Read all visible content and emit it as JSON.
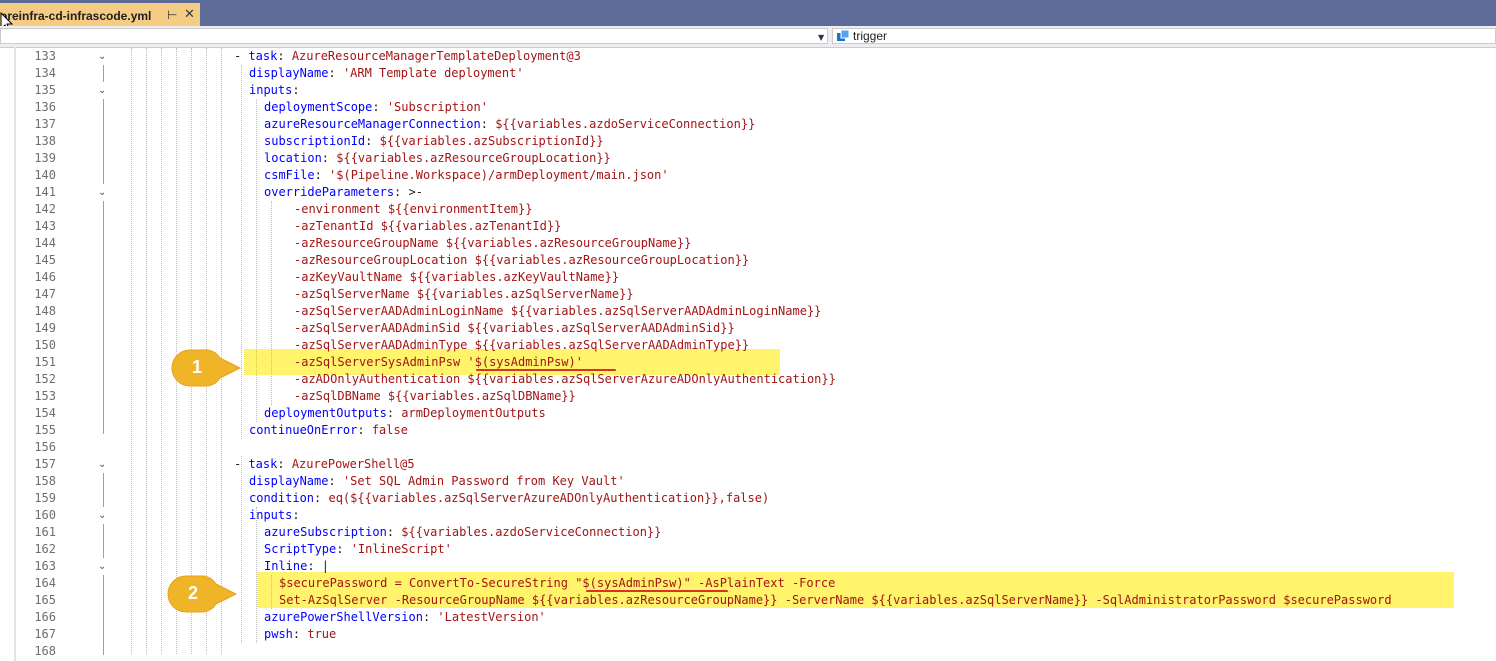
{
  "tab": {
    "title": "oreinfra-cd-infrascode.yml",
    "pin_glyph": "⊢",
    "close_glyph": "✕"
  },
  "navbar": {
    "right_icon": "trigger-icon",
    "right_label": "trigger"
  },
  "callouts": [
    {
      "label": "1"
    },
    {
      "label": "2"
    }
  ],
  "colors": {
    "tab_active": "#f5cc84",
    "titlebar": "#5d6b99",
    "highlight": "#fff46b",
    "underline": "#d9322a",
    "badge": "#f0b429",
    "key": "#0000ff",
    "value": "#a31515"
  },
  "lines": [
    {
      "n": "133",
      "fold": true,
      "parts": [
        [
          "p",
          "- "
        ],
        [
          "k",
          "task"
        ],
        [
          "p",
          ": "
        ],
        [
          "v",
          "AzureResourceManagerTemplateDeployment@3"
        ]
      ]
    },
    {
      "n": "134",
      "parts": [
        [
          "k",
          "displayName"
        ],
        [
          "p",
          ": "
        ],
        [
          "s",
          "'ARM Template deployment'"
        ]
      ]
    },
    {
      "n": "135",
      "fold": true,
      "parts": [
        [
          "k",
          "inputs"
        ],
        [
          "p",
          ":"
        ]
      ]
    },
    {
      "n": "136",
      "parts": [
        [
          "k",
          "deploymentScope"
        ],
        [
          "p",
          ": "
        ],
        [
          "s",
          "'Subscription'"
        ]
      ]
    },
    {
      "n": "137",
      "parts": [
        [
          "k",
          "azureResourceManagerConnection"
        ],
        [
          "p",
          ": "
        ],
        [
          "v",
          "${{variables.azdoServiceConnection}}"
        ]
      ]
    },
    {
      "n": "138",
      "parts": [
        [
          "k",
          "subscriptionId"
        ],
        [
          "p",
          ": "
        ],
        [
          "v",
          "${{variables.azSubscriptionId}}"
        ]
      ]
    },
    {
      "n": "139",
      "parts": [
        [
          "k",
          "location"
        ],
        [
          "p",
          ": "
        ],
        [
          "v",
          "${{variables.azResourceGroupLocation}}"
        ]
      ]
    },
    {
      "n": "140",
      "parts": [
        [
          "k",
          "csmFile"
        ],
        [
          "p",
          ": "
        ],
        [
          "s",
          "'$(Pipeline.Workspace)/armDeployment/main.json'"
        ]
      ]
    },
    {
      "n": "141",
      "fold": true,
      "parts": [
        [
          "k",
          "overrideParameters"
        ],
        [
          "p",
          ": >-"
        ]
      ]
    },
    {
      "n": "142",
      "parts": [
        [
          "v",
          "-environment ${{environmentItem}}"
        ]
      ]
    },
    {
      "n": "143",
      "parts": [
        [
          "v",
          "-azTenantId ${{variables.azTenantId}}"
        ]
      ]
    },
    {
      "n": "144",
      "parts": [
        [
          "v",
          "-azResourceGroupName ${{variables.azResourceGroupName}}"
        ]
      ]
    },
    {
      "n": "145",
      "parts": [
        [
          "v",
          "-azResourceGroupLocation ${{variables.azResourceGroupLocation}}"
        ]
      ]
    },
    {
      "n": "146",
      "parts": [
        [
          "v",
          "-azKeyVaultName ${{variables.azKeyVaultName}}"
        ]
      ]
    },
    {
      "n": "147",
      "parts": [
        [
          "v",
          "-azSqlServerName ${{variables.azSqlServerName}}"
        ]
      ]
    },
    {
      "n": "148",
      "parts": [
        [
          "v",
          "-azSqlServerAADAdminLoginName ${{variables.azSqlServerAADAdminLoginName}}"
        ]
      ]
    },
    {
      "n": "149",
      "parts": [
        [
          "v",
          "-azSqlServerAADAdminSid ${{variables.azSqlServerAADAdminSid}}"
        ]
      ]
    },
    {
      "n": "150",
      "parts": [
        [
          "v",
          "-azSqlServerAADAdminType ${{variables.azSqlServerAADAdminType}}"
        ]
      ]
    },
    {
      "n": "151",
      "parts": [
        [
          "v",
          "-azSqlServerSysAdminPsw '$(sysAdminPsw)'"
        ]
      ]
    },
    {
      "n": "152",
      "parts": [
        [
          "v",
          "-azADOnlyAuthentication ${{variables.azSqlServerAzureADOnlyAuthentication}}"
        ]
      ]
    },
    {
      "n": "153",
      "parts": [
        [
          "v",
          "-azSqlDBName ${{variables.azSqlDBName}}"
        ]
      ]
    },
    {
      "n": "154",
      "parts": [
        [
          "k",
          "deploymentOutputs"
        ],
        [
          "p",
          ": "
        ],
        [
          "v",
          "armDeploymentOutputs"
        ]
      ]
    },
    {
      "n": "155",
      "parts": [
        [
          "k",
          "continueOnError"
        ],
        [
          "p",
          ": "
        ],
        [
          "v",
          "false"
        ]
      ]
    },
    {
      "n": "156",
      "parts": []
    },
    {
      "n": "157",
      "fold": true,
      "parts": [
        [
          "p",
          "- "
        ],
        [
          "k",
          "task"
        ],
        [
          "p",
          ": "
        ],
        [
          "v",
          "AzurePowerShell@5"
        ]
      ]
    },
    {
      "n": "158",
      "parts": [
        [
          "k",
          "displayName"
        ],
        [
          "p",
          ": "
        ],
        [
          "s",
          "'Set SQL Admin Password from Key Vault'"
        ]
      ]
    },
    {
      "n": "159",
      "parts": [
        [
          "k",
          "condition"
        ],
        [
          "p",
          ": "
        ],
        [
          "v",
          "eq(${{variables.azSqlServerAzureADOnlyAuthentication}},false)"
        ]
      ]
    },
    {
      "n": "160",
      "fold": true,
      "parts": [
        [
          "k",
          "inputs"
        ],
        [
          "p",
          ":"
        ]
      ]
    },
    {
      "n": "161",
      "parts": [
        [
          "k",
          "azureSubscription"
        ],
        [
          "p",
          ": "
        ],
        [
          "v",
          "${{variables.azdoServiceConnection}}"
        ]
      ]
    },
    {
      "n": "162",
      "parts": [
        [
          "k",
          "ScriptType"
        ],
        [
          "p",
          ": "
        ],
        [
          "s",
          "'InlineScript'"
        ]
      ]
    },
    {
      "n": "163",
      "fold": true,
      "parts": [
        [
          "k",
          "Inline"
        ],
        [
          "p",
          ": |"
        ]
      ]
    },
    {
      "n": "164",
      "parts": [
        [
          "v",
          "$securePassword = ConvertTo-SecureString \"$(sysAdminPsw)\" -AsPlainText -Force"
        ]
      ]
    },
    {
      "n": "165",
      "parts": [
        [
          "v",
          "Set-AzSqlServer -ResourceGroupName ${{variables.azResourceGroupName}} -ServerName ${{variables.azSqlServerName}} -SqlAdministratorPassword $securePassword"
        ]
      ]
    },
    {
      "n": "166",
      "parts": [
        [
          "k",
          "azurePowerShellVersion"
        ],
        [
          "p",
          ": "
        ],
        [
          "s",
          "'LatestVersion'"
        ]
      ]
    },
    {
      "n": "167",
      "parts": [
        [
          "k",
          "pwsh"
        ],
        [
          "p",
          ": "
        ],
        [
          "v",
          "true"
        ]
      ]
    },
    {
      "n": "168",
      "parts": []
    }
  ]
}
